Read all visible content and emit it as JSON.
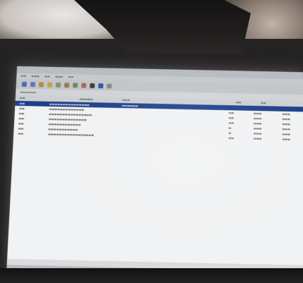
{
  "window": {
    "title_text": "",
    "menu": [
      "",
      "",
      "",
      "",
      "",
      ""
    ]
  },
  "toolbar": {
    "icons": [
      "back-icon",
      "forward-icon",
      "refresh-icon",
      "folder-icon",
      "settings-icon",
      "tools-icon",
      "search-icon",
      "user-icon",
      "home-icon",
      "info-icon",
      "help-icon"
    ]
  },
  "list": {
    "rows": [
      {
        "selected": true
      },
      {
        "selected": false
      },
      {
        "selected": false
      },
      {
        "selected": false
      },
      {
        "selected": false
      },
      {
        "selected": false
      },
      {
        "selected": false
      }
    ]
  },
  "colors": {
    "selection": "#1d3f8a",
    "list_bg": "#f1f2f3",
    "chrome": "#c2c5c9"
  }
}
